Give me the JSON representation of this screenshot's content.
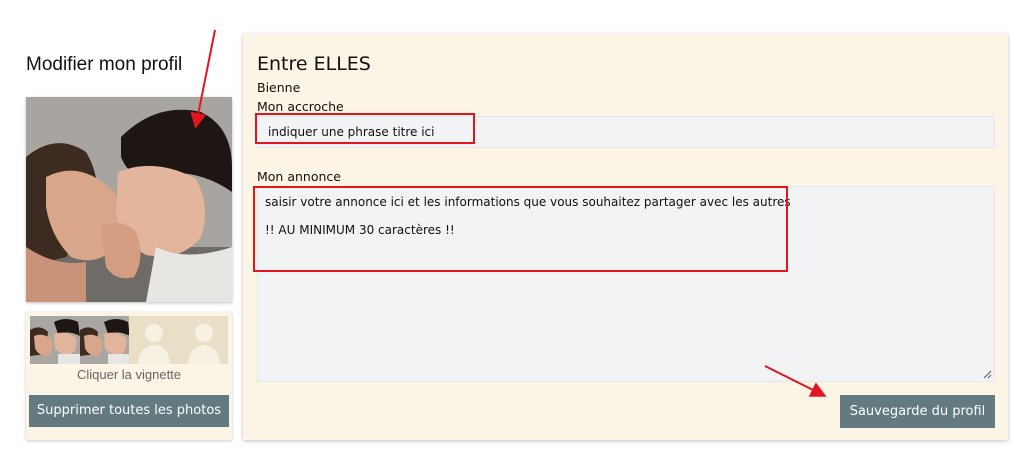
{
  "page": {
    "title": "Modifier mon profil"
  },
  "gallery": {
    "hint": "Cliquer la vignette",
    "delete_all_label": "Supprimer toutes les photos",
    "thumbnails": [
      "photo",
      "photo",
      "empty",
      "empty"
    ]
  },
  "profile": {
    "name": "Entre ELLES",
    "city": "Bienne"
  },
  "form": {
    "hook_label": "Mon accroche",
    "hook_value": "indiquer une phrase titre ici",
    "ad_label": "Mon annonce",
    "ad_lines": [
      "saisir votre annonce ici et les informations que vous souhaitez partager avec les autres",
      "",
      "!! AU MINIMUM 30 caractères !!"
    ],
    "save_label": "Sauvegarde du profil"
  },
  "colors": {
    "panel_background": "#fcf4e4",
    "button_background": "#637a80",
    "field_background": "#f1f3f5",
    "annotation_red": "#e3151f"
  }
}
